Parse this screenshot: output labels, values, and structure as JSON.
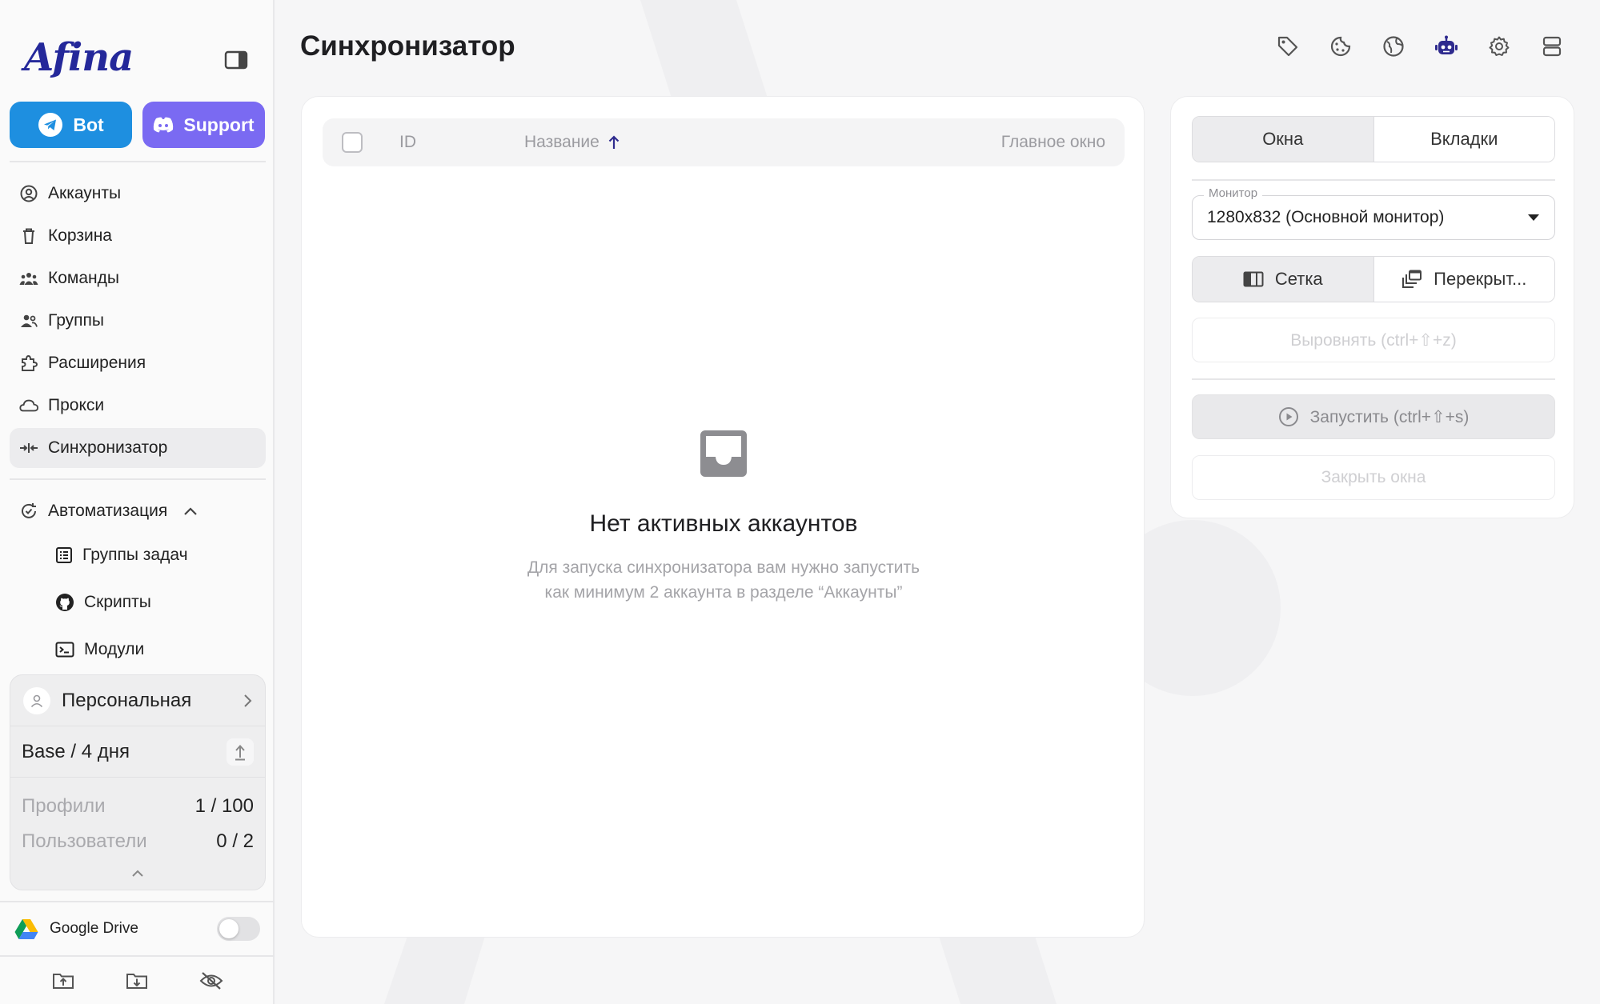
{
  "colors": {
    "brand": "#24289a",
    "bot_button": "#1e8fe0",
    "support_button": "#7a6af2",
    "active_nav_bg": "#ececee"
  },
  "sidebar": {
    "logo": "Afina",
    "bot_label": "Bot",
    "support_label": "Support",
    "nav": [
      {
        "label": "Аккаунты",
        "icon": "account-circle-icon"
      },
      {
        "label": "Корзина",
        "icon": "trash-icon"
      },
      {
        "label": "Команды",
        "icon": "teams-icon"
      },
      {
        "label": "Группы",
        "icon": "groups-icon"
      },
      {
        "label": "Расширения",
        "icon": "puzzle-icon"
      },
      {
        "label": "Прокси",
        "icon": "cloud-icon"
      },
      {
        "label": "Синхронизатор",
        "icon": "sync-icon",
        "active": true
      }
    ],
    "automation": {
      "label": "Автоматизация",
      "items": [
        {
          "label": "Группы задач",
          "icon": "task-list-icon"
        },
        {
          "label": "Скрипты",
          "icon": "github-icon"
        },
        {
          "label": "Модули",
          "icon": "terminal-icon"
        }
      ]
    },
    "plan": {
      "workspace": "Персональная",
      "tier": "Base / 4 дня",
      "stats": [
        {
          "label": "Профили",
          "value": "1 / 100"
        },
        {
          "label": "Пользователи",
          "value": "0 / 2"
        }
      ]
    },
    "google_drive": {
      "label": "Google Drive",
      "enabled": false
    }
  },
  "header": {
    "title": "Синхронизатор",
    "icons": [
      "tag-icon",
      "cookie-icon",
      "globe-icon",
      "robot-icon",
      "settings-icon",
      "server-icon"
    ]
  },
  "table": {
    "columns": {
      "id": "ID",
      "name": "Название",
      "main_window": "Главное окно"
    },
    "empty_title": "Нет активных аккаунтов",
    "empty_desc": "Для запуска синхронизатора вам нужно запустить как минимум 2 аккаунта в разделе “Аккаунты”"
  },
  "controls": {
    "tabs": [
      {
        "label": "Окна",
        "selected": true
      },
      {
        "label": "Вкладки",
        "selected": false
      }
    ],
    "monitor_label": "Монитор",
    "monitor_value": "1280x832 (Основной монитор)",
    "layout_options": [
      {
        "label": "Сетка",
        "selected": true
      },
      {
        "label": "Перекрыт...",
        "selected": false
      }
    ],
    "align_label": "Выровнять (ctrl+⇧+z)",
    "start_label": "Запустить (ctrl+⇧+s)",
    "close_label": "Закрыть окна"
  }
}
